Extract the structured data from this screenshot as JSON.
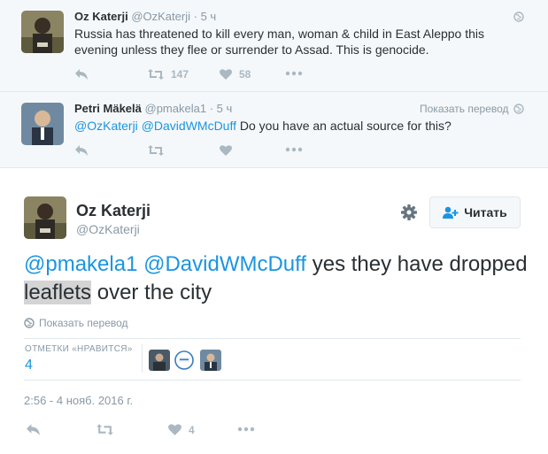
{
  "tweet1": {
    "name": "Oz Katerji",
    "handle": "@OzKaterji",
    "dot": "·",
    "time": "5 ч",
    "text": "Russia has threatened to kill every man, woman & child in East Aleppo this evening unless they flee or surrender to Assad. This is genocide.",
    "retweets": "147",
    "likes": "58"
  },
  "tweet2": {
    "name": "Petri Mäkelä",
    "handle": "@pmakela1",
    "dot": "·",
    "time": "5 ч",
    "translate": "Показать перевод",
    "mention1": "@OzKaterji",
    "mention2": "@DavidWMcDuff",
    "text": "Do you have an actual source for this?"
  },
  "main": {
    "name": "Oz Katerji",
    "handle": "@OzKaterji",
    "follow_label": "Читать",
    "mention1": "@pmakela1",
    "mention2": "@DavidWMcDuff",
    "text_before": " yes they have dropped ",
    "highlight": "leaflets",
    "text_after": " over the city",
    "translate": "Показать перевод",
    "likes_label": "ОТМЕТКИ «НРАВИТСЯ»",
    "likes_count": "4",
    "timestamp": "2:56 - 4 нояб. 2016 г.",
    "likes_action_count": "4"
  },
  "colors": {
    "link": "#1b95e0",
    "muted": "#8899a6",
    "icon": "#aab8c2",
    "context_bg": "#f5f8fa"
  }
}
